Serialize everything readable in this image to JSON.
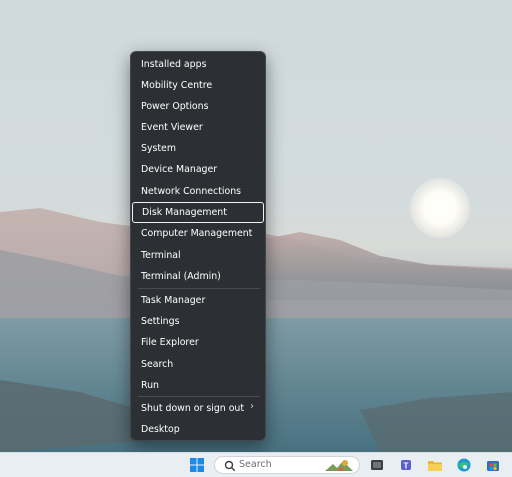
{
  "context_menu": {
    "items": [
      {
        "label": "Installed apps"
      },
      {
        "label": "Mobility Centre"
      },
      {
        "label": "Power Options"
      },
      {
        "label": "Event Viewer"
      },
      {
        "label": "System"
      },
      {
        "label": "Device Manager"
      },
      {
        "label": "Network Connections"
      },
      {
        "label": "Disk Management",
        "selected": true
      },
      {
        "label": "Computer Management"
      },
      {
        "label": "Terminal"
      },
      {
        "label": "Terminal (Admin)"
      },
      {
        "label": "Task Manager"
      },
      {
        "label": "Settings"
      },
      {
        "label": "File Explorer"
      },
      {
        "label": "Search"
      },
      {
        "label": "Run"
      },
      {
        "label": "Shut down or sign out",
        "has_submenu": true
      },
      {
        "label": "Desktop"
      }
    ]
  },
  "taskbar": {
    "search_placeholder": "Search",
    "icons": [
      "start-icon",
      "search-icon",
      "task-view-icon",
      "teams-icon",
      "file-explorer-icon",
      "edge-icon",
      "store-icon"
    ]
  },
  "colors": {
    "menu_bg": "#2c2f33",
    "menu_text": "#ffffff",
    "selection_border": "#f2f2f2",
    "taskbar_bg": "#e9eef2"
  }
}
